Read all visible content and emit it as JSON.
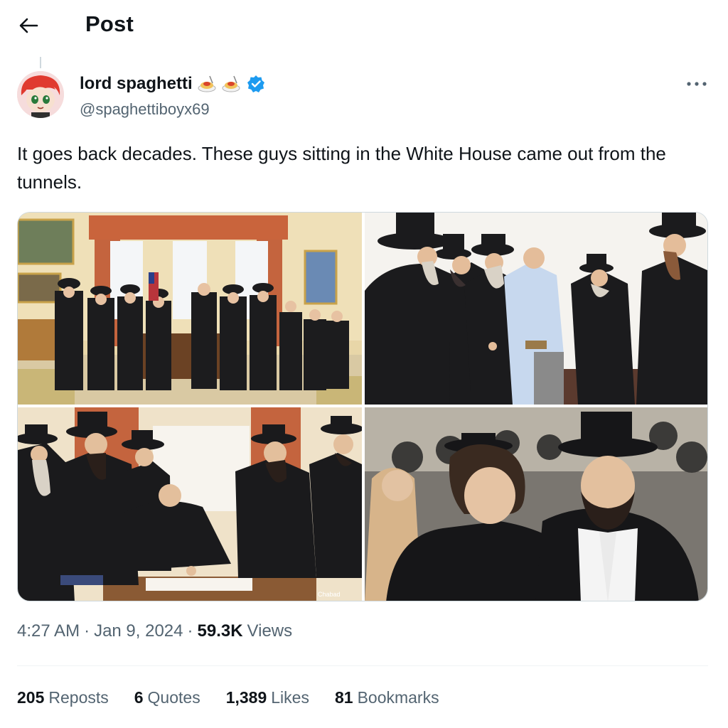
{
  "header": {
    "title": "Post",
    "back_icon": "arrow-left-icon"
  },
  "author": {
    "display_name": "lord spaghetti",
    "emoji": [
      "spaghetti-plate",
      "spaghetti-plate"
    ],
    "handle": "@spaghettiboyx69",
    "verified": true,
    "verified_color": "#1d9bf0"
  },
  "more_icon": "more-horizontal-icon",
  "post": {
    "text": "It goes back decades. These guys sitting in the White House came out from the tunnels."
  },
  "media": [
    {
      "name": "photo-oval-office-group"
    },
    {
      "name": "photo-handshake-group"
    },
    {
      "name": "photo-signing-desk",
      "watermark": "Chabad"
    },
    {
      "name": "photo-crowd-portrait"
    }
  ],
  "meta": {
    "time": "4:27 AM",
    "date": "Jan 9, 2024",
    "views_count": "59.3K",
    "views_label": "Views",
    "separator": "·"
  },
  "stats": {
    "reposts": {
      "count": "205",
      "label": "Reposts"
    },
    "quotes": {
      "count": "6",
      "label": "Quotes"
    },
    "likes": {
      "count": "1,389",
      "label": "Likes"
    },
    "bookmarks": {
      "count": "81",
      "label": "Bookmarks"
    }
  }
}
